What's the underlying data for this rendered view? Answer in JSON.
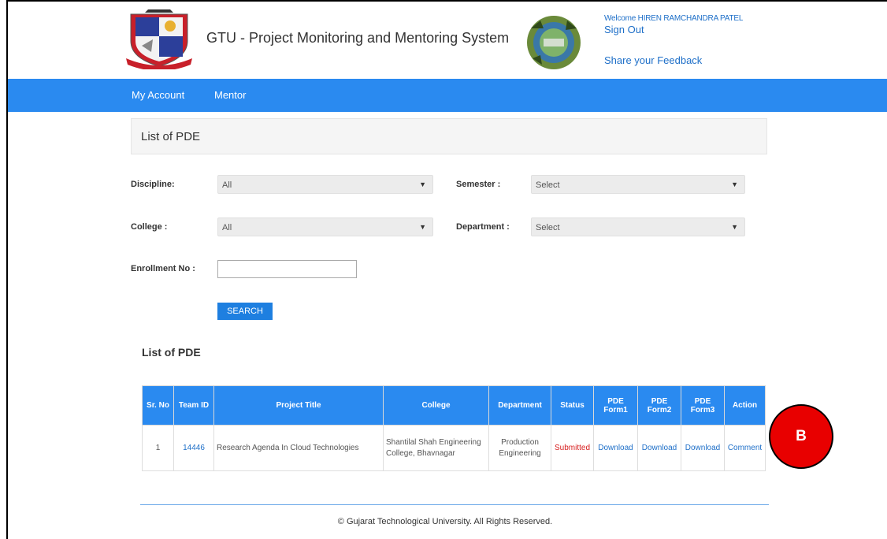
{
  "header": {
    "site_title": "GTU - Project Monitoring and Mentoring System",
    "welcome": "Welcome HIREN RAMCHANDRA PATEL",
    "sign_out": "Sign Out",
    "feedback": "Share your Feedback"
  },
  "nav": {
    "items": [
      {
        "label": "My Account"
      },
      {
        "label": "Mentor"
      }
    ]
  },
  "panel": {
    "title": "List of PDE"
  },
  "filters": {
    "discipline": {
      "label": "Discipline:",
      "value": "All"
    },
    "semester": {
      "label": "Semester :",
      "value": "Select"
    },
    "college": {
      "label": "College :",
      "value": "All"
    },
    "department": {
      "label": "Department :",
      "value": "Select"
    },
    "enrollment": {
      "label": "Enrollment No :",
      "value": ""
    },
    "search_button": "SEARCH"
  },
  "list_title": "List of PDE",
  "table": {
    "headers": [
      "Sr. No",
      "Team ID",
      "Project Title",
      "College",
      "Department",
      "Status",
      "PDE Form1",
      "PDE Form2",
      "PDE Form3",
      "Action"
    ],
    "rows": [
      {
        "sr": "1",
        "team_id": "14446",
        "title": "Research Agenda In Cloud Technologies",
        "college": "Shantilal Shah Engineering College, Bhavnagar",
        "department": "Production Engineering",
        "status": "Submitted",
        "form1": "Download",
        "form2": "Download",
        "form3": "Download",
        "action": "Comment"
      }
    ]
  },
  "annotation": {
    "badge": "B"
  },
  "footer": {
    "copyright": "© Gujarat Technological University. All Rights Reserved."
  },
  "colors": {
    "nav_bg": "#2a8af0",
    "link": "#1e6fc8",
    "status_red": "#d72020",
    "badge_red": "#e80000"
  }
}
